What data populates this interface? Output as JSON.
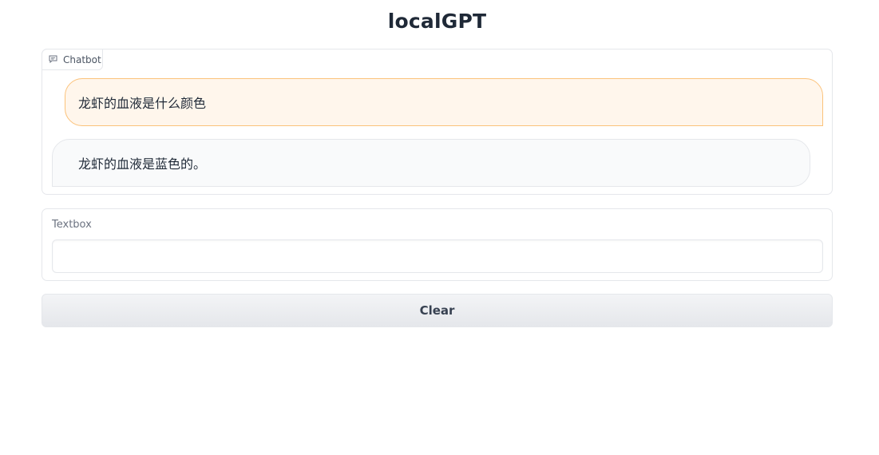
{
  "app": {
    "title": "localGPT"
  },
  "chatbot": {
    "label": "Chatbot",
    "messages": [
      {
        "role": "user",
        "text": "龙虾的血液是什么颜色"
      },
      {
        "role": "bot",
        "text": "龙虾的血液是蓝色的。"
      }
    ]
  },
  "textbox": {
    "label": "Textbox",
    "value": "",
    "placeholder": ""
  },
  "actions": {
    "clear_label": "Clear"
  },
  "colors": {
    "user_bubble_bg": "#fff6ec",
    "user_bubble_border": "#fbc27a",
    "bot_bubble_bg": "#f9fafb",
    "border": "#e5e7eb"
  },
  "icons": {
    "chatbot_label": "chat-icon"
  }
}
